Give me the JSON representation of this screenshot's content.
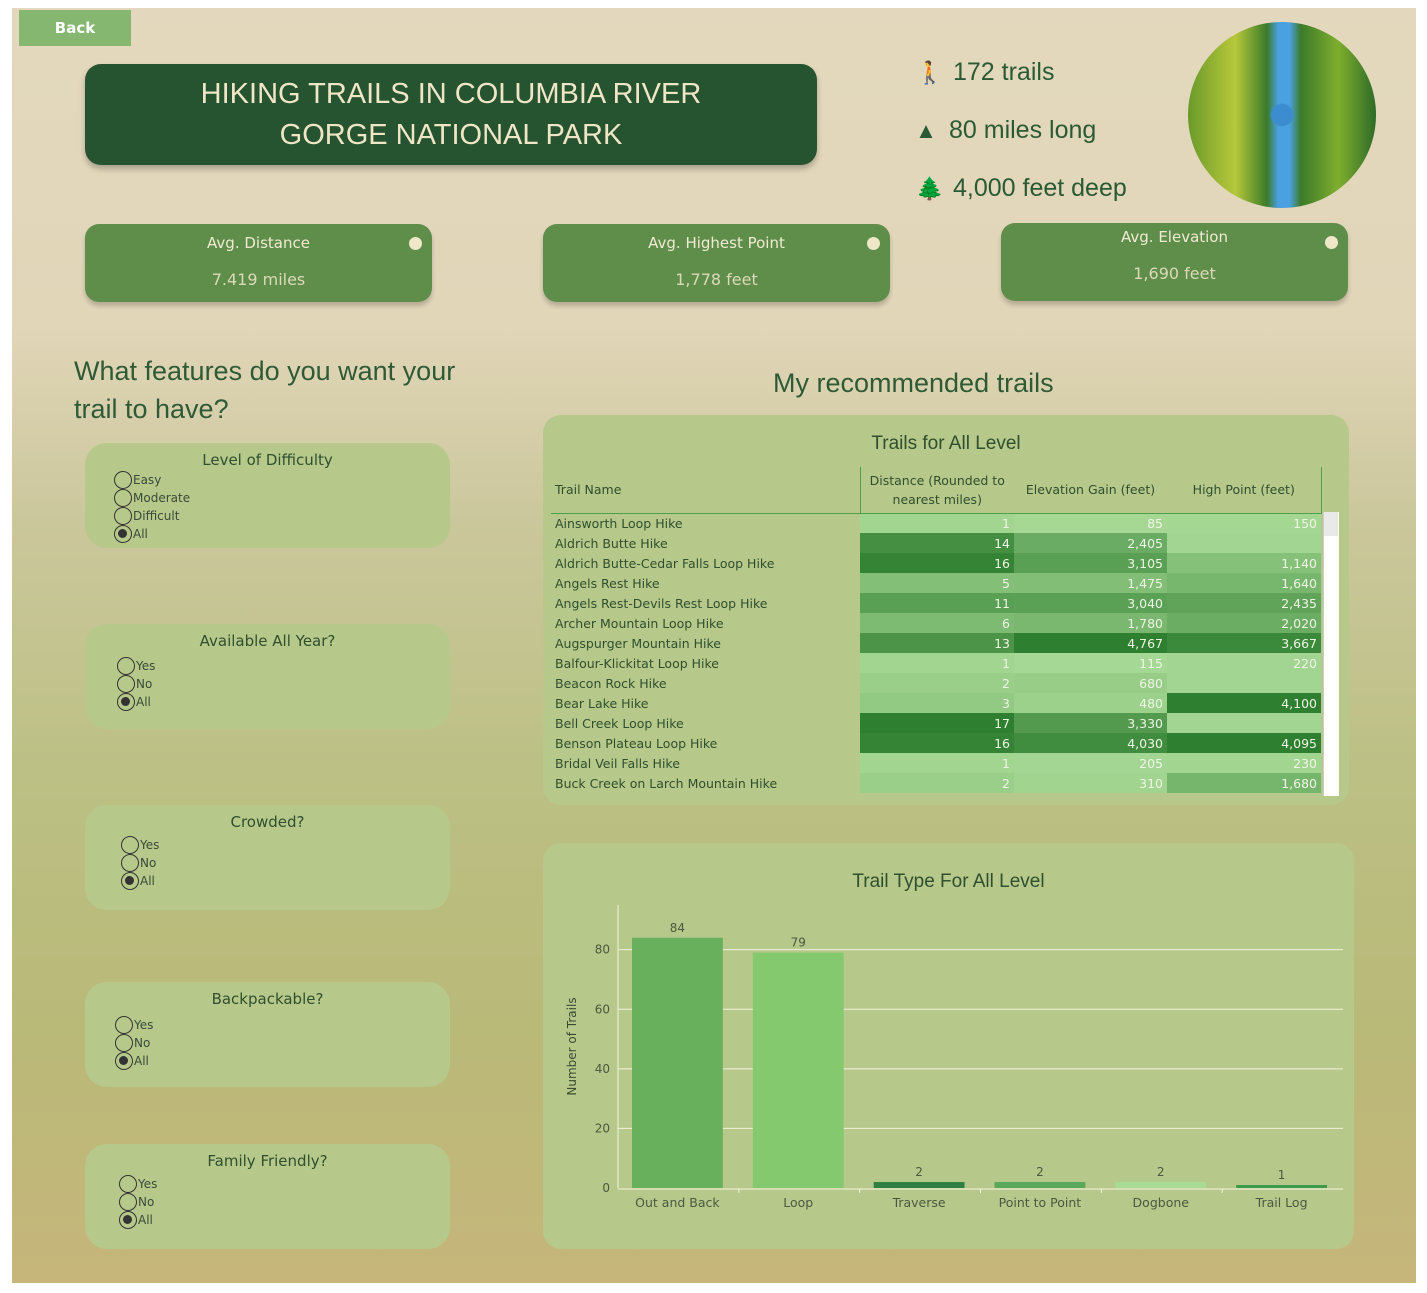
{
  "back_label": "Back",
  "title": "HIKING TRAILS IN COLUMBIA RIVER GORGE NATIONAL PARK",
  "facts": [
    {
      "icon": "hiker-icon",
      "text": "172 trails"
    },
    {
      "icon": "mountain-icon",
      "text": "80 miles long"
    },
    {
      "icon": "tree-icon",
      "text": "4,000 feet deep"
    }
  ],
  "kpis": [
    {
      "label": "Avg. Distance",
      "value": "7.419 miles"
    },
    {
      "label": "Avg. Highest Point",
      "value": "1,778 feet"
    },
    {
      "label": "Avg. Elevation",
      "value": "1,690 feet"
    }
  ],
  "question": "What features do you want your trail to have?",
  "recommended": "My recommended trails",
  "filters": [
    {
      "title": "Level of Difficulty",
      "options": [
        "Easy",
        "Moderate",
        "Difficult",
        "All"
      ],
      "selected": "All"
    },
    {
      "title": "Available All Year?",
      "options": [
        "Yes",
        "No",
        "All"
      ],
      "selected": "All"
    },
    {
      "title": "Crowded?",
      "options": [
        "Yes",
        "No",
        "All"
      ],
      "selected": "All"
    },
    {
      "title": "Backpackable?",
      "options": [
        "Yes",
        "No",
        "All"
      ],
      "selected": "All"
    },
    {
      "title": "Family Friendly?",
      "options": [
        "Yes",
        "No",
        "All"
      ],
      "selected": "All"
    }
  ],
  "table": {
    "title": "Trails for All Level",
    "columns": [
      "Trail Name",
      "Distance (Rounded to nearest miles)",
      "Elevation Gain (feet)",
      "High Point (feet)"
    ],
    "rows": [
      [
        "Ainsworth Loop Hike",
        "1",
        "85",
        "150"
      ],
      [
        "Aldrich Butte Hike",
        "14",
        "2,405",
        ""
      ],
      [
        "Aldrich Butte-Cedar Falls Loop Hike",
        "16",
        "3,105",
        "1,140"
      ],
      [
        "Angels Rest Hike",
        "5",
        "1,475",
        "1,640"
      ],
      [
        "Angels Rest-Devils Rest Loop Hike",
        "11",
        "3,040",
        "2,435"
      ],
      [
        "Archer Mountain Loop Hike",
        "6",
        "1,780",
        "2,020"
      ],
      [
        "Augspurger Mountain Hike",
        "13",
        "4,767",
        "3,667"
      ],
      [
        "Balfour-Klickitat Loop Hike",
        "1",
        "115",
        "220"
      ],
      [
        "Beacon Rock Hike",
        "2",
        "680",
        ""
      ],
      [
        "Bear Lake Hike",
        "3",
        "480",
        "4,100"
      ],
      [
        "Bell Creek Loop Hike",
        "17",
        "3,330",
        ""
      ],
      [
        "Benson Plateau Loop Hike",
        "16",
        "4,030",
        "4,095"
      ],
      [
        "Bridal Veil Falls Hike",
        "1",
        "205",
        "230"
      ],
      [
        "Buck Creek on Larch Mountain Hike",
        "2",
        "310",
        "1,680"
      ]
    ]
  },
  "chart_data": {
    "type": "bar",
    "title": "Trail Type For All Level",
    "ylabel": "Number of Trails",
    "xlabel": "",
    "categories": [
      "Out and Back",
      "Loop",
      "Traverse",
      "Point to Point",
      "Dogbone",
      "Trail Log"
    ],
    "values": [
      84,
      79,
      2,
      2,
      2,
      1
    ],
    "colors": [
      "#69b05c",
      "#85c96f",
      "#2e7f41",
      "#5aa95a",
      "#a8dc95",
      "#3c9a4c"
    ],
    "yticks": [
      0,
      20,
      40,
      60,
      80
    ],
    "ylim": [
      0,
      95
    ],
    "grid": true
  }
}
